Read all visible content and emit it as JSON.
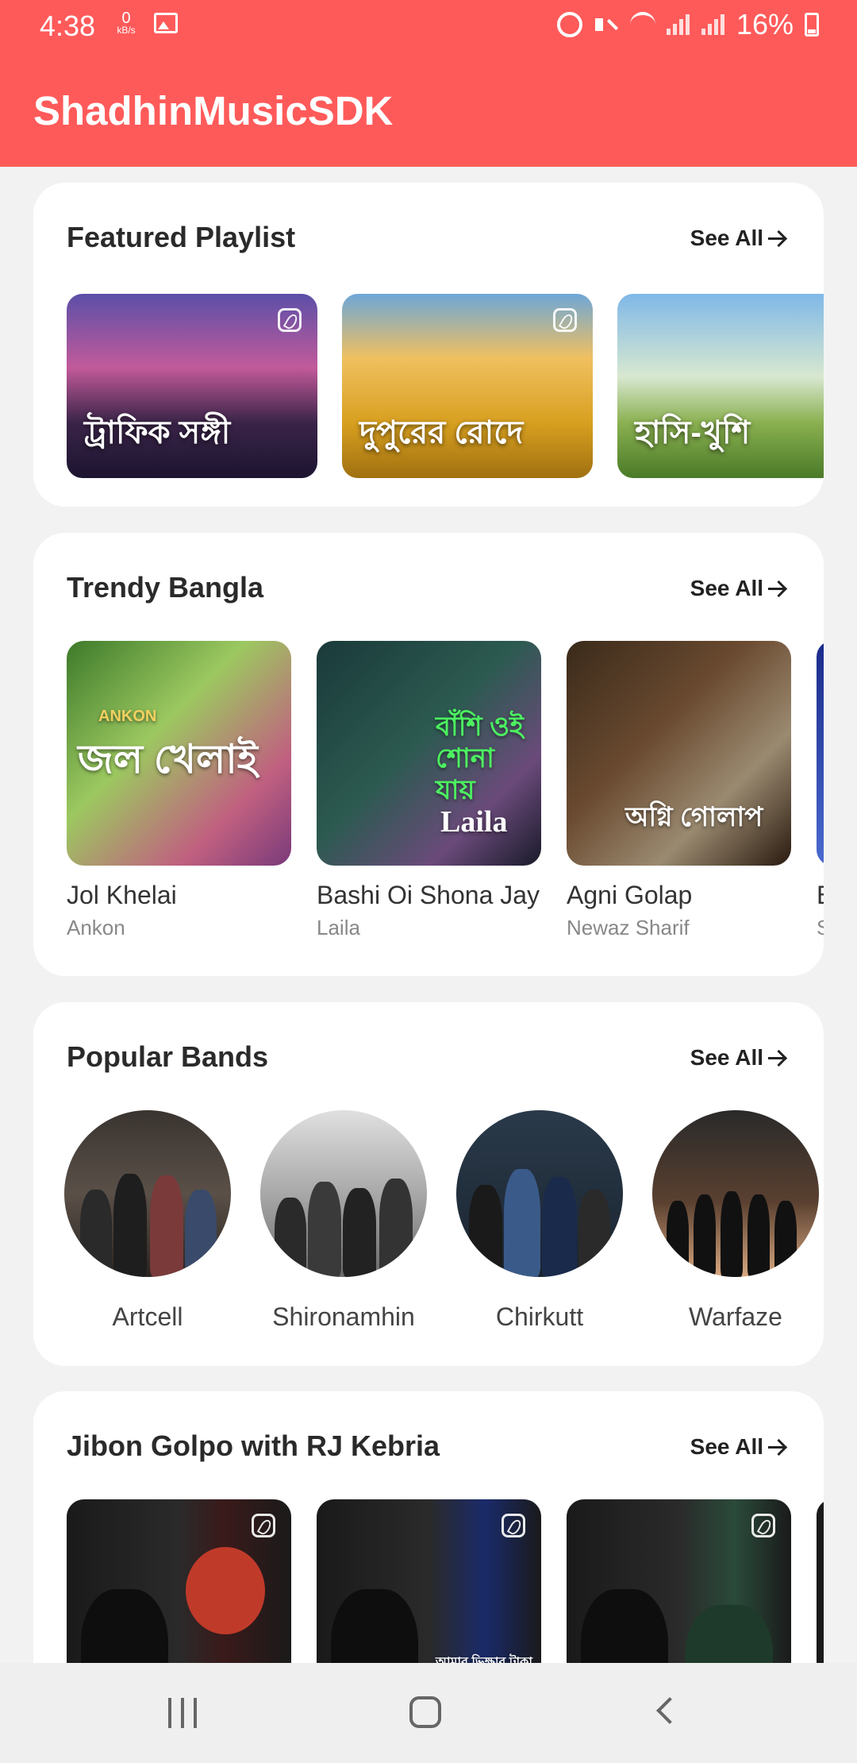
{
  "status_bar": {
    "time": "4:38",
    "net_speed_value": "0",
    "net_speed_unit": "kB/s",
    "battery": "16%"
  },
  "app_bar": {
    "title": "ShadhinMusicSDK"
  },
  "see_all_label": "See All",
  "featured": {
    "title": "Featured Playlist",
    "items": [
      {
        "label": "ট্রাফিক সঙ্গী"
      },
      {
        "label": "দুপুরের রোদে"
      },
      {
        "label": "হাসি-খুশি"
      }
    ]
  },
  "trendy": {
    "title": "Trendy Bangla",
    "items": [
      {
        "title": "Jol Khelai",
        "artist": "Ankon",
        "art_text": "জল খেলাই",
        "art_sub": "ANKON"
      },
      {
        "title": "Bashi Oi Shona Jay",
        "artist": "Laila",
        "art_text": "বাঁশি ওই শোনা যায়",
        "art_sub": "Laila"
      },
      {
        "title": "Agni Golap",
        "artist": "Newaz Sharif",
        "art_text": "অগ্নি গোলাপ",
        "art_sub": ""
      },
      {
        "title": "B",
        "artist": "S"
      }
    ]
  },
  "bands": {
    "title": "Popular Bands",
    "items": [
      {
        "name": "Artcell"
      },
      {
        "name": "Shironamhin"
      },
      {
        "name": "Chirkutt"
      },
      {
        "name": "Warfaze"
      }
    ]
  },
  "jibon": {
    "title": "Jibon Golpo with RJ Kebria",
    "items": [
      {
        "art_text": ""
      },
      {
        "art_text": "আমার ভিক্ষার টাকা"
      },
      {
        "art_text": ""
      }
    ]
  },
  "colors": {
    "accent": "#ff5a5a",
    "card": "#ffffff",
    "background": "#f2f2f2"
  }
}
